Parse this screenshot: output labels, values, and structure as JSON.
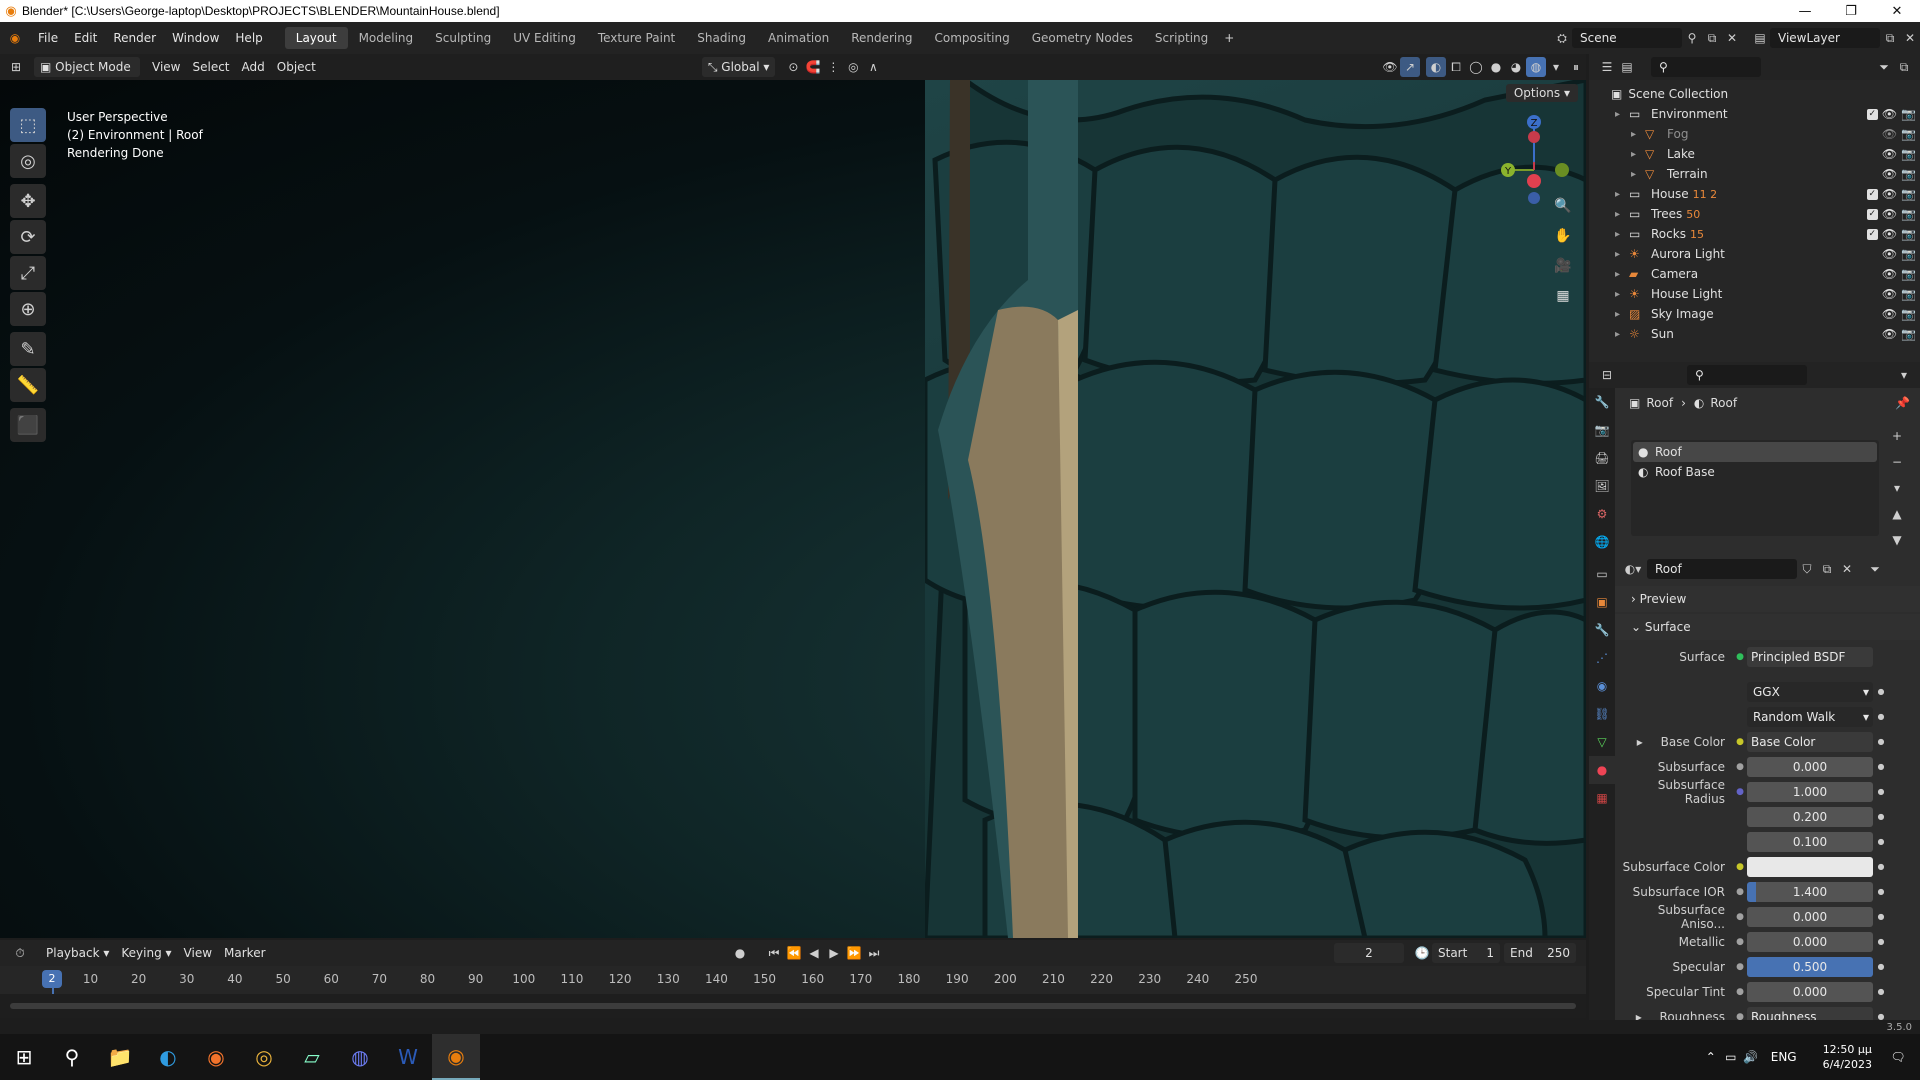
{
  "window": {
    "title": "Blender* [C:\\Users\\George-laptop\\Desktop\\PROJECTS\\BLENDER\\MountainHouse.blend]"
  },
  "menus": [
    "File",
    "Edit",
    "Render",
    "Window",
    "Help"
  ],
  "workspaces": [
    "Layout",
    "Modeling",
    "Sculpting",
    "UV Editing",
    "Texture Paint",
    "Shading",
    "Animation",
    "Rendering",
    "Compositing",
    "Geometry Nodes",
    "Scripting"
  ],
  "active_workspace": "Layout",
  "scene": "Scene",
  "view_layer": "ViewLayer",
  "viewport_header": {
    "mode": "Object Mode",
    "menus": [
      "View",
      "Select",
      "Add",
      "Object"
    ],
    "orientation": "Global"
  },
  "viewport": {
    "info_line1": "User Perspective",
    "info_line2": "(2) Environment | Roof",
    "info_line3": "Rendering Done",
    "options": "Options",
    "gizmo_axes": {
      "z": "Z",
      "y": "Y"
    }
  },
  "timeline": {
    "menus": [
      "Playback",
      "Keying",
      "View",
      "Marker"
    ],
    "current_frame": "2",
    "start_label": "Start",
    "start": "1",
    "end_label": "End",
    "end": "250",
    "frame_marks": [
      "10",
      "20",
      "30",
      "40",
      "50",
      "60",
      "70",
      "80",
      "90",
      "100",
      "110",
      "120",
      "130",
      "140",
      "150",
      "160",
      "170",
      "180",
      "190",
      "200",
      "210",
      "220",
      "230",
      "240",
      "250"
    ]
  },
  "outliner": {
    "root": "Scene Collection",
    "items": [
      {
        "name": "Environment",
        "icon": "collection-icon",
        "color": "#e0e0e0",
        "indent": 1,
        "checkbox": true
      },
      {
        "name": "Fog",
        "icon": "mesh-icon",
        "color": "#e8883a",
        "indent": 2,
        "dim": true,
        "badge": ""
      },
      {
        "name": "Lake",
        "icon": "mesh-icon",
        "color": "#e8883a",
        "indent": 2,
        "badge": ""
      },
      {
        "name": "Terrain",
        "icon": "mesh-icon",
        "color": "#e8883a",
        "indent": 2,
        "badge": ""
      },
      {
        "name": "House",
        "icon": "collection-icon",
        "color": "#e0e0e0",
        "indent": 1,
        "checkbox": true,
        "badge": "11 2"
      },
      {
        "name": "Trees",
        "icon": "collection-icon",
        "color": "#e0e0e0",
        "indent": 1,
        "checkbox": true,
        "badge": "50"
      },
      {
        "name": "Rocks",
        "icon": "collection-icon",
        "color": "#e0e0e0",
        "indent": 1,
        "checkbox": true,
        "badge": "15"
      },
      {
        "name": "Aurora Light",
        "icon": "light-icon",
        "color": "#e8883a",
        "indent": 1,
        "badge": ""
      },
      {
        "name": "Camera",
        "icon": "camera-icon",
        "color": "#e8883a",
        "indent": 1,
        "badge": ""
      },
      {
        "name": "House Light",
        "icon": "light-icon",
        "color": "#e8883a",
        "indent": 1,
        "badge": ""
      },
      {
        "name": "Sky Image",
        "icon": "image-icon",
        "color": "#e8883a",
        "indent": 1,
        "badge": ""
      },
      {
        "name": "Sun",
        "icon": "sun-icon",
        "color": "#e8883a",
        "indent": 1,
        "badge": ""
      }
    ]
  },
  "properties": {
    "breadcrumb": [
      "Roof",
      "Roof"
    ],
    "slots": [
      "Roof",
      "Roof Base"
    ],
    "material_name": "Roof",
    "panels": {
      "preview": "Preview",
      "surface": "Surface"
    },
    "surface_shader_label": "Surface",
    "surface_shader": "Principled BSDF",
    "distribution": "GGX",
    "subsurface_method": "Random Walk",
    "fields": [
      {
        "label": "Base Color",
        "value": "Base Color",
        "kind": "link",
        "sock": "#c7c729",
        "expand": true
      },
      {
        "label": "Subsurface",
        "value": "0.000",
        "kind": "num",
        "sock": "#a1a1a1"
      },
      {
        "label": "Subsurface Radius",
        "value": "1.000",
        "kind": "num",
        "sock": "#6363c7"
      },
      {
        "label": "",
        "value": "0.200",
        "kind": "num",
        "sock": ""
      },
      {
        "label": "",
        "value": "0.100",
        "kind": "num",
        "sock": ""
      },
      {
        "label": "Subsurface Color",
        "value": "",
        "kind": "white",
        "sock": "#c7c729"
      },
      {
        "label": "Subsurface IOR",
        "value": "1.400",
        "kind": "num",
        "sock": "#a1a1a1",
        "fill": 0.07
      },
      {
        "label": "Subsurface Aniso...",
        "value": "0.000",
        "kind": "num",
        "sock": "#a1a1a1"
      },
      {
        "label": "Metallic",
        "value": "0.000",
        "kind": "num",
        "sock": "#a1a1a1"
      },
      {
        "label": "Specular",
        "value": "0.500",
        "kind": "blue",
        "sock": "#a1a1a1"
      },
      {
        "label": "Specular Tint",
        "value": "0.000",
        "kind": "num",
        "sock": "#a1a1a1"
      },
      {
        "label": "Roughness",
        "value": "Roughness",
        "kind": "link",
        "sock": "#a1a1a1",
        "expand": true
      }
    ]
  },
  "status": {
    "version": "3.5.0"
  },
  "taskbar": {
    "time": "12:50 μμ",
    "date": "6/4/2023",
    "lang": "ENG"
  }
}
